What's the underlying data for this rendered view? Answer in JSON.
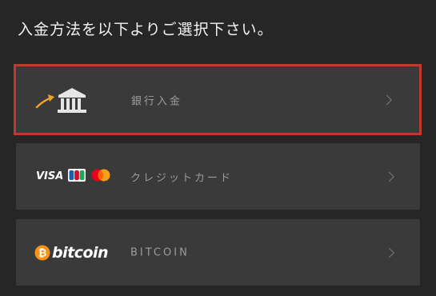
{
  "header": {
    "title": "入金方法を以下よりご選択下さい。"
  },
  "options": [
    {
      "label": "銀行入金",
      "icon": "bank-icon",
      "selected": true
    },
    {
      "label": "クレジットカード",
      "icons": [
        "visa-logo",
        "jcb-logo",
        "mastercard-logo"
      ],
      "visa_text": "VISA",
      "selected": false
    },
    {
      "label": "BITCOIN",
      "icon": "bitcoin-logo",
      "logo_text": "bitcoin",
      "selected": false
    }
  ],
  "colors": {
    "background": "#262626",
    "option_background": "#3a3a3a",
    "selected_border": "#c0392b",
    "bitcoin_orange": "#f7931a",
    "bank_arrow": "#f0a22a"
  }
}
